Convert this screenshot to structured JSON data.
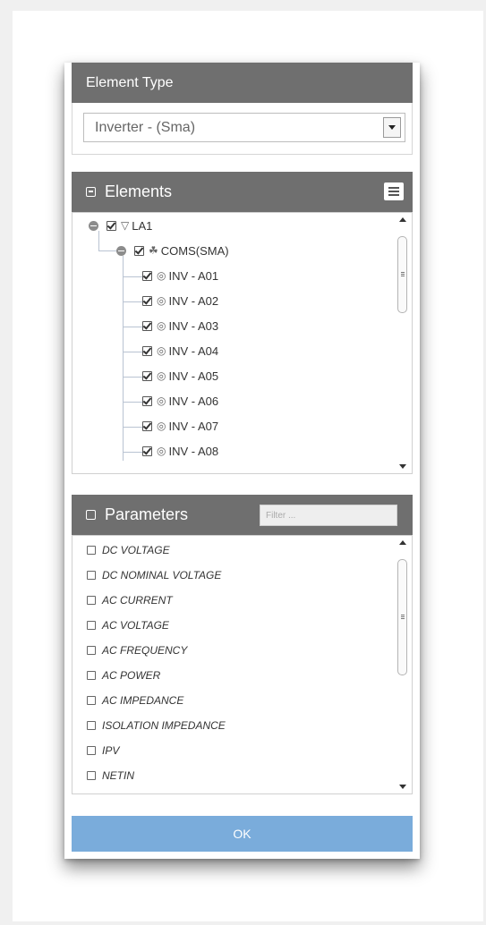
{
  "element_type": {
    "header": "Element Type",
    "selected": "Inverter - (Sma)"
  },
  "elements": {
    "header": "Elements",
    "tree": {
      "root": {
        "label": "LA1",
        "icon": "wifi-icon",
        "checked": true
      },
      "group": {
        "label": "COMS(SMA)",
        "icon": "network-icon",
        "checked": true
      },
      "items": [
        {
          "label": "INV - A01",
          "checked": true
        },
        {
          "label": "INV - A02",
          "checked": true
        },
        {
          "label": "INV - A03",
          "checked": true
        },
        {
          "label": "INV - A04",
          "checked": true
        },
        {
          "label": "INV - A05",
          "checked": true
        },
        {
          "label": "INV - A06",
          "checked": true
        },
        {
          "label": "INV - A07",
          "checked": true
        },
        {
          "label": "INV - A08",
          "checked": true
        }
      ]
    }
  },
  "parameters": {
    "header": "Parameters",
    "filter_placeholder": "Filter ...",
    "items": [
      {
        "label": "DC VOLTAGE",
        "checked": false
      },
      {
        "label": "DC NOMINAL VOLTAGE",
        "checked": false
      },
      {
        "label": "AC CURRENT",
        "checked": false
      },
      {
        "label": "AC VOLTAGE",
        "checked": false
      },
      {
        "label": "AC FREQUENCY",
        "checked": false
      },
      {
        "label": "AC POWER",
        "checked": false
      },
      {
        "label": "AC IMPEDANCE",
        "checked": false
      },
      {
        "label": "ISOLATION IMPEDANCE",
        "checked": false
      },
      {
        "label": "IPV",
        "checked": false
      },
      {
        "label": "NETIN",
        "checked": false
      }
    ]
  },
  "ok_label": "OK",
  "colors": {
    "header_bg": "#6f6f6f",
    "ok_bg": "#7aacdb"
  }
}
